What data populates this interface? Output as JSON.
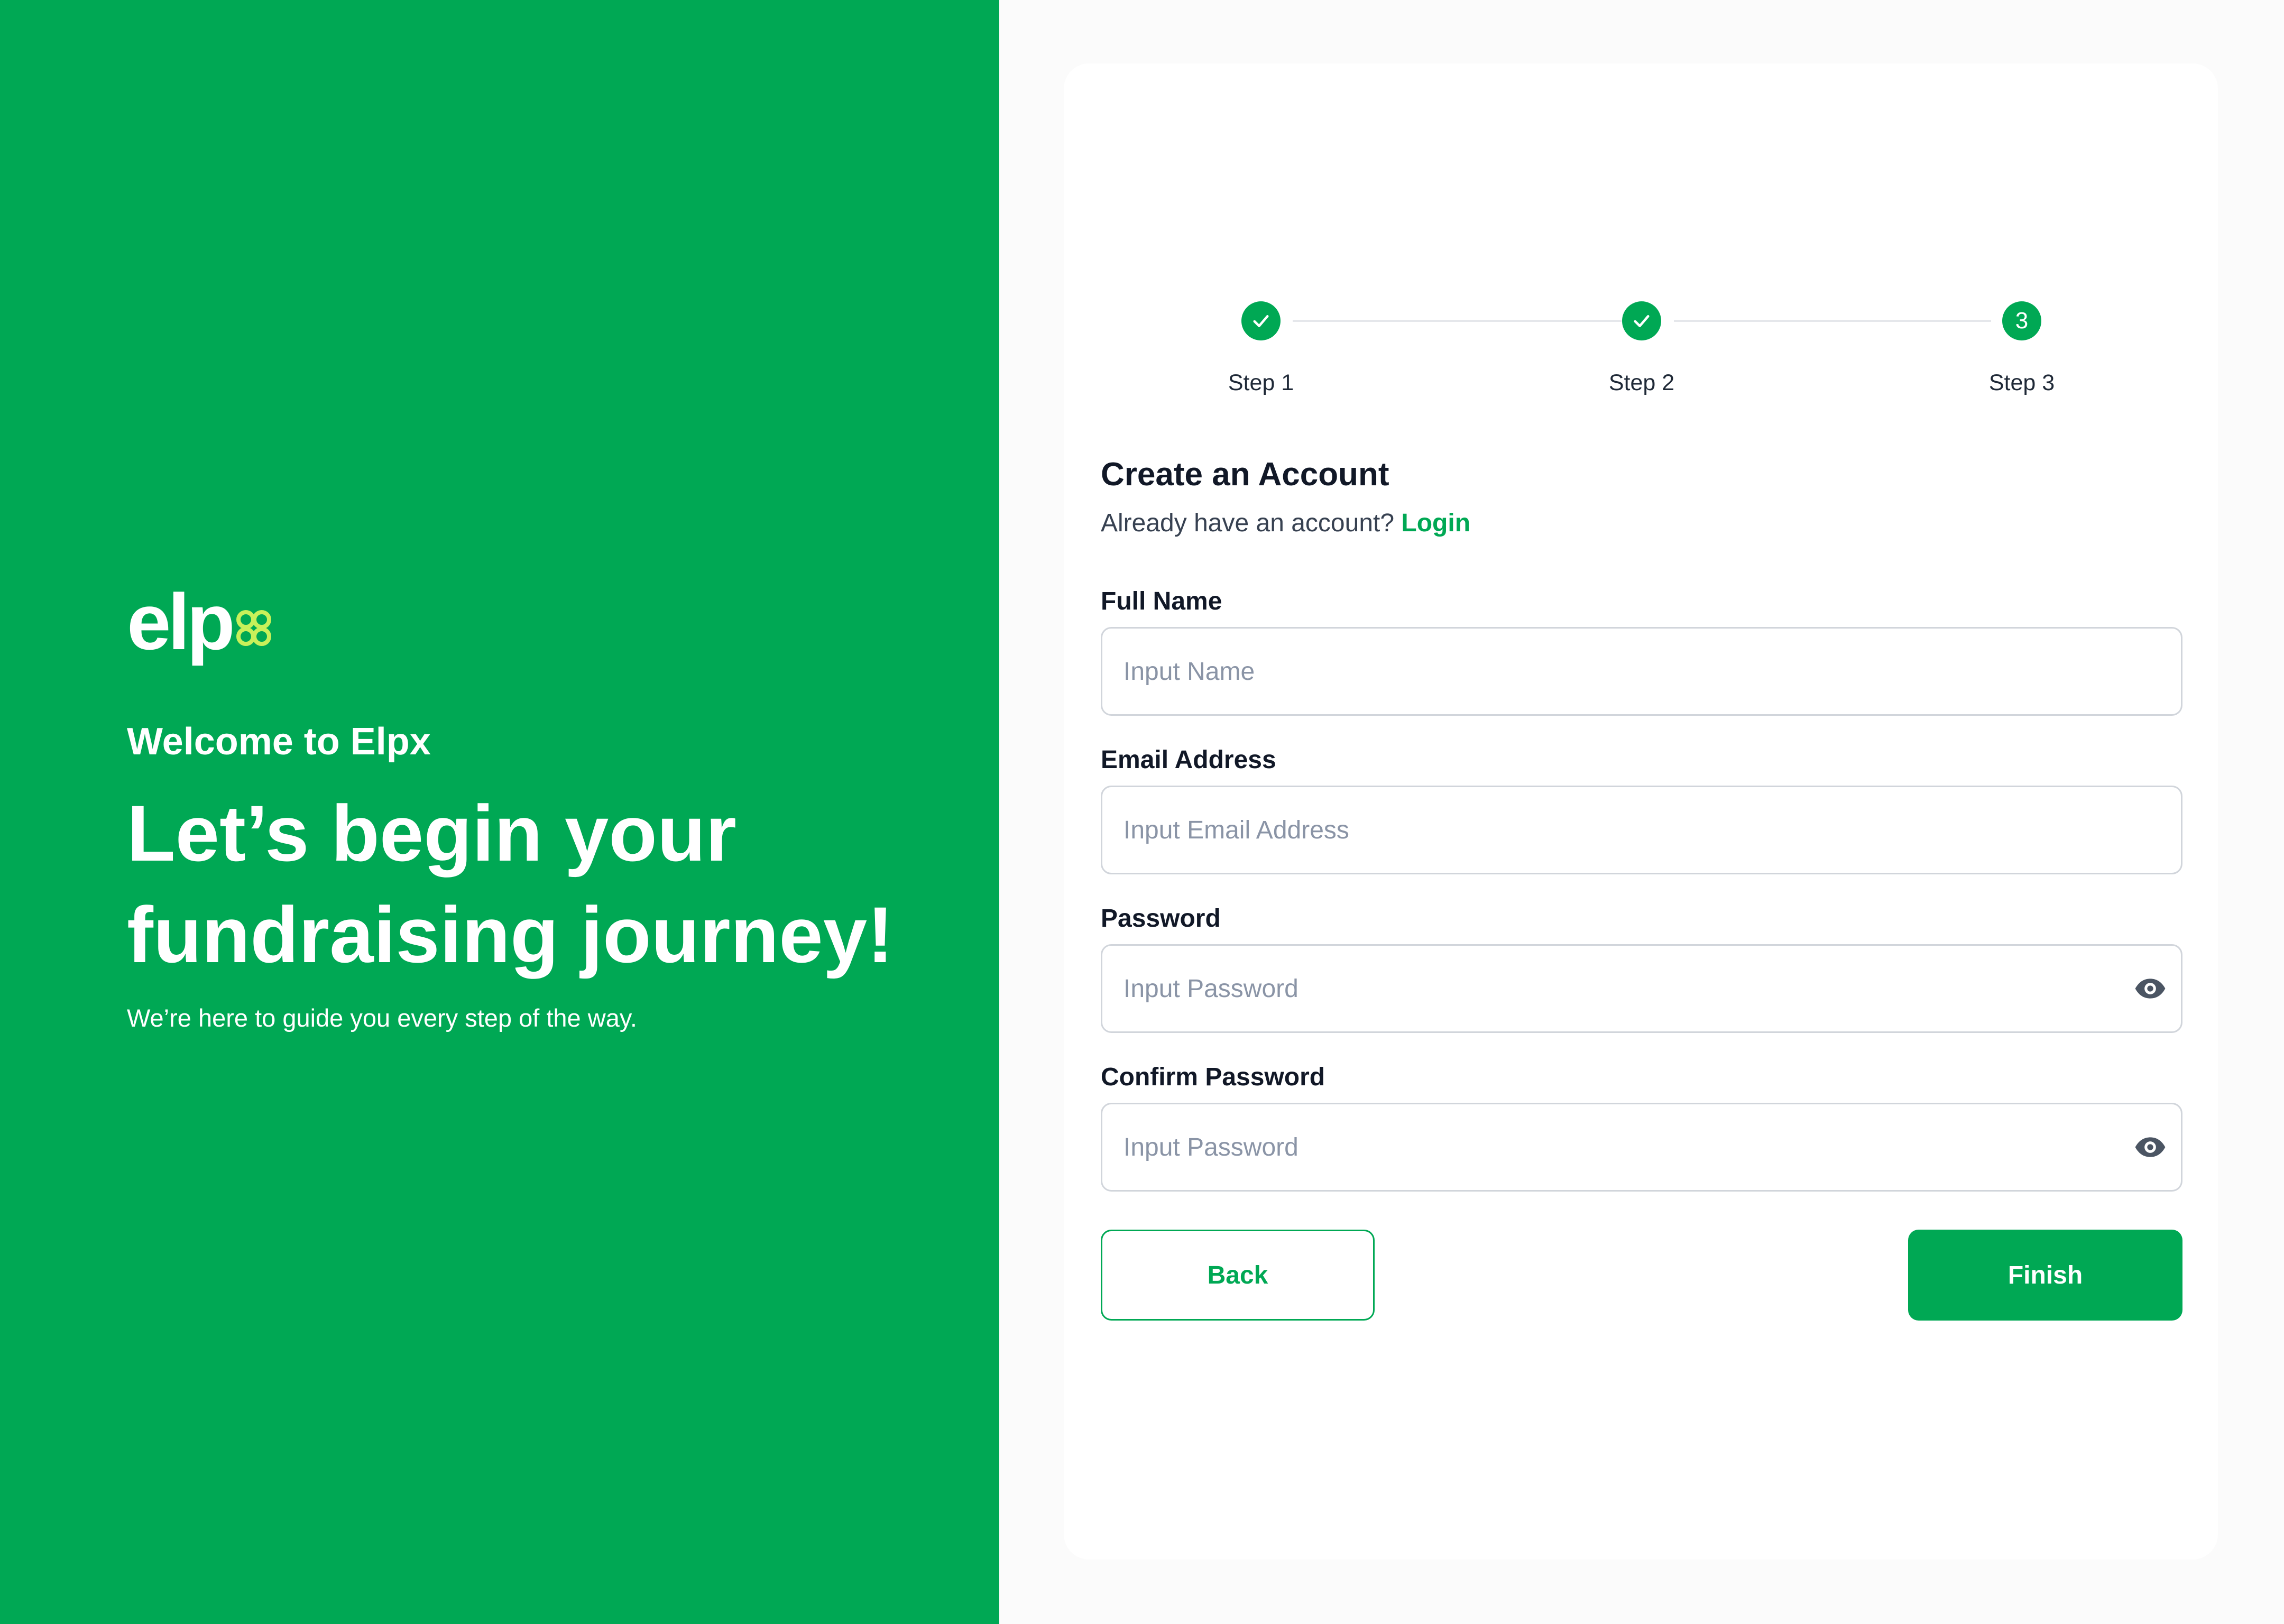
{
  "brand": {
    "logo_text": "elpx",
    "welcome": "Welcome to Elpx",
    "headline": "Let’s begin your fundraising journey!",
    "subtext": "We’re here to guide you every step of the way."
  },
  "colors": {
    "primary": "#00a854",
    "logo_accent": "#c8f05a",
    "page_background": "#fbfbfb",
    "card_background": "#ffffff",
    "input_border": "#d1d5db",
    "placeholder": "#8a94a6"
  },
  "stepper": {
    "current_step": 3,
    "steps": [
      {
        "label": "Step 1",
        "state": "completed",
        "icon": "check-icon"
      },
      {
        "label": "Step 2",
        "state": "completed",
        "icon": "check-icon"
      },
      {
        "label": "Step 3",
        "state": "active",
        "number": "3"
      }
    ]
  },
  "form": {
    "title": "Create an Account",
    "subtitle": "Already have an account?",
    "login_link": "Login",
    "fields": {
      "full_name": {
        "label": "Full Name",
        "placeholder": "Input Name",
        "value": ""
      },
      "email": {
        "label": "Email Address",
        "placeholder": "Input Email Address",
        "value": ""
      },
      "password": {
        "label": "Password",
        "placeholder": "Input Password",
        "value": "",
        "icon": "eye-icon"
      },
      "confirm_password": {
        "label": "Confirm Password",
        "placeholder": "Input Password",
        "value": "",
        "icon": "eye-icon"
      }
    },
    "back_label": "Back",
    "finish_label": "Finish"
  }
}
